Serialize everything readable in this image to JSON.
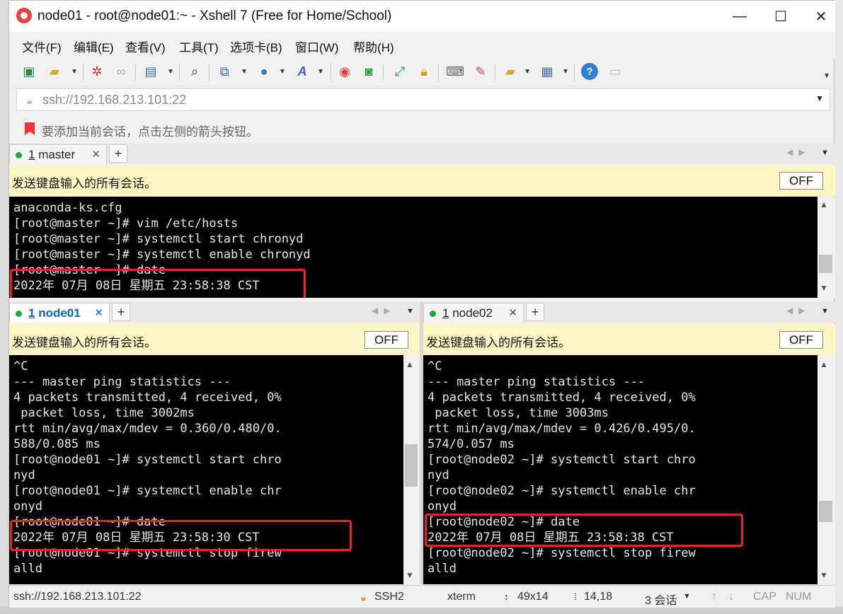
{
  "window": {
    "title": "node01 - root@node01:~ - Xshell 7 (Free for Home/School)",
    "min_glyph": "—",
    "max_glyph": "☐",
    "close_glyph": "✕"
  },
  "menu": [
    "文件(F)",
    "编辑(E)",
    "查看(V)",
    "工具(T)",
    "选项卡(B)",
    "窗口(W)",
    "帮助(H)"
  ],
  "toolbar": {
    "icons": [
      "new-session-icon",
      "open-folder-icon",
      "disconnect-icon",
      "reconnect-icon",
      "properties-icon",
      "find-icon",
      "transfer-icon",
      "globe-icon",
      "font-icon",
      "xftp-icon",
      "xmanager-icon",
      "fullscreen-icon",
      "lock-icon",
      "keyboard-icon",
      "highlight-icon",
      "new-tab-group-icon",
      "layout-icon",
      "help-icon",
      "chat-icon"
    ]
  },
  "address": {
    "value": "ssh://192.168.213.101:22"
  },
  "hint": {
    "text": "要添加当前会话，点击左侧的箭头按钮。"
  },
  "send_all": {
    "text": "发送键盘输入的所有会话。",
    "toggle": "OFF"
  },
  "panes": {
    "master": {
      "tab": {
        "index": "1",
        "name": "master"
      },
      "lines": [
        "anaconda-ks.cfg",
        "[root@master ~]# vim /etc/hosts",
        "[root@master ~]# systemctl start chronyd",
        "[root@master ~]# systemctl enable chronyd",
        "[root@master ~]# date",
        "2022年 07月 08日 星期五 23:58:38 CST"
      ]
    },
    "node01": {
      "tab": {
        "index": "1",
        "name": "node01"
      },
      "lines": [
        "^C",
        "--- master ping statistics ---",
        "4 packets transmitted, 4 received, 0%",
        " packet loss, time 3002ms",
        "rtt min/avg/max/mdev = 0.360/0.480/0.",
        "588/0.085 ms",
        "[root@node01 ~]# systemctl start chro",
        "nyd",
        "[root@node01 ~]# systemctl enable chr",
        "onyd",
        "[root@node01 ~]# date",
        "2022年 07月 08日 星期五 23:58:30 CST",
        "[root@node01 ~]# systemctl stop firew",
        "alld"
      ]
    },
    "node02": {
      "tab": {
        "index": "1",
        "name": "node02"
      },
      "lines": [
        "^C",
        "--- master ping statistics ---",
        "4 packets transmitted, 4 received, 0%",
        " packet loss, time 3003ms",
        "rtt min/avg/max/mdev = 0.426/0.495/0.",
        "574/0.057 ms",
        "[root@node02 ~]# systemctl start chro",
        "nyd",
        "[root@node02 ~]# systemctl enable chr",
        "onyd",
        "[root@node02 ~]# date",
        "2022年 07月 08日 星期五 23:58:38 CST",
        "[root@node02 ~]# systemctl stop firew",
        "alld"
      ]
    }
  },
  "status": {
    "connection": "ssh://192.168.213.101:22",
    "protocol": "SSH2",
    "terminal": "xterm",
    "size": "49x14",
    "cursor": "14,18",
    "sessions": "3 会话",
    "cap": "CAP",
    "num": "NUM"
  },
  "colors": {
    "highlight_box": "#e8232a",
    "send_bar_bg": "#fdf6c3",
    "active_tab_text": "#0b62c8",
    "status_dot": "#1cac3a"
  }
}
